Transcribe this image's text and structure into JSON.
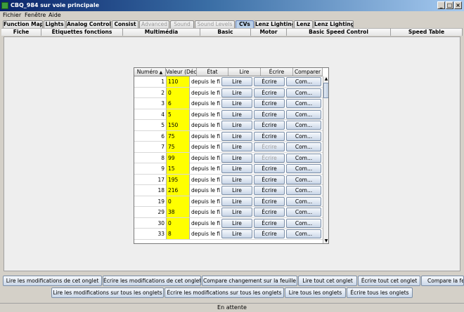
{
  "window": {
    "title": "CBQ_984 sur voie principale"
  },
  "menu": [
    "Fichier",
    "Fenêtre",
    "Aide"
  ],
  "tabs_row1": [
    {
      "label": "Function Map",
      "disabled": false,
      "selected": false
    },
    {
      "label": "Lights",
      "disabled": false,
      "selected": false
    },
    {
      "label": "Analog Controls",
      "disabled": false,
      "selected": false
    },
    {
      "label": "Consist",
      "disabled": false,
      "selected": false
    },
    {
      "label": "Advanced",
      "disabled": true,
      "selected": false
    },
    {
      "label": "Sound",
      "disabled": true,
      "selected": false
    },
    {
      "label": "Sound Levels",
      "disabled": true,
      "selected": false
    },
    {
      "label": "CVs",
      "disabled": false,
      "selected": true
    },
    {
      "label": "Lenz Lighting",
      "disabled": false,
      "selected": false
    },
    {
      "label": "Lenz",
      "disabled": false,
      "selected": false
    },
    {
      "label": "Lenz Lighting",
      "disabled": false,
      "selected": false
    }
  ],
  "tabs_row2": [
    "Fiche",
    "Étiquettes fonctions",
    "Multimédia",
    "Basic",
    "Motor",
    "Basic Speed Control",
    "Speed Table"
  ],
  "table": {
    "columns": [
      "Numéro",
      "Valeur (Déc...",
      "État",
      "Lire",
      "Écrire",
      "Comparer"
    ],
    "sort_icon": "▲",
    "rows": [
      {
        "num": "1",
        "val": "110",
        "etat": "depuis le fi...",
        "lire": "Lire",
        "ecrire": "Écrire",
        "ecrire_disabled": false,
        "comp": "Com..."
      },
      {
        "num": "2",
        "val": "0",
        "etat": "depuis le fi...",
        "lire": "Lire",
        "ecrire": "Écrire",
        "ecrire_disabled": false,
        "comp": "Com..."
      },
      {
        "num": "3",
        "val": "6",
        "etat": "depuis le fi...",
        "lire": "Lire",
        "ecrire": "Écrire",
        "ecrire_disabled": false,
        "comp": "Com..."
      },
      {
        "num": "4",
        "val": "5",
        "etat": "depuis le fi...",
        "lire": "Lire",
        "ecrire": "Écrire",
        "ecrire_disabled": false,
        "comp": "Com..."
      },
      {
        "num": "5",
        "val": "150",
        "etat": "depuis le fi...",
        "lire": "Lire",
        "ecrire": "Écrire",
        "ecrire_disabled": false,
        "comp": "Com..."
      },
      {
        "num": "6",
        "val": "75",
        "etat": "depuis le fi...",
        "lire": "Lire",
        "ecrire": "Écrire",
        "ecrire_disabled": false,
        "comp": "Com..."
      },
      {
        "num": "7",
        "val": "75",
        "etat": "depuis le fi...",
        "lire": "Lire",
        "ecrire": "Écrire",
        "ecrire_disabled": true,
        "comp": "Com..."
      },
      {
        "num": "8",
        "val": "99",
        "etat": "depuis le fi...",
        "lire": "Lire",
        "ecrire": "Écrire",
        "ecrire_disabled": true,
        "comp": "Com..."
      },
      {
        "num": "9",
        "val": "15",
        "etat": "depuis le fi...",
        "lire": "Lire",
        "ecrire": "Écrire",
        "ecrire_disabled": false,
        "comp": "Com..."
      },
      {
        "num": "17",
        "val": "195",
        "etat": "depuis le fi...",
        "lire": "Lire",
        "ecrire": "Écrire",
        "ecrire_disabled": false,
        "comp": "Com..."
      },
      {
        "num": "18",
        "val": "216",
        "etat": "depuis le fi...",
        "lire": "Lire",
        "ecrire": "Écrire",
        "ecrire_disabled": false,
        "comp": "Com..."
      },
      {
        "num": "19",
        "val": "0",
        "etat": "depuis le fi...",
        "lire": "Lire",
        "ecrire": "Écrire",
        "ecrire_disabled": false,
        "comp": "Com..."
      },
      {
        "num": "29",
        "val": "38",
        "etat": "depuis le fi...",
        "lire": "Lire",
        "ecrire": "Écrire",
        "ecrire_disabled": false,
        "comp": "Com..."
      },
      {
        "num": "30",
        "val": "0",
        "etat": "depuis le fi...",
        "lire": "Lire",
        "ecrire": "Écrire",
        "ecrire_disabled": false,
        "comp": "Com..."
      },
      {
        "num": "33",
        "val": "8",
        "etat": "depuis le fi...",
        "lire": "Lire",
        "ecrire": "Écrire",
        "ecrire_disabled": false,
        "comp": "Com..."
      }
    ]
  },
  "actions_row1": [
    "Lire les modifications de cet onglet",
    "Écrire les modifications de cet onglet",
    "Compare changement sur la feuille",
    "Lire tout cet onglet",
    "Écrire tout cet onglet",
    "Compare la feu"
  ],
  "actions_row2": [
    "Lire les modifications sur tous les onglets",
    "Écrire les modifications sur tous les onglets",
    "Lire tous les onglets",
    "Écrire tous les onglets"
  ],
  "status": "En attente",
  "colors": {
    "cv_value_bg": "#ffff00",
    "selected_tab": "#b9cfe8",
    "title_bar": "#0a246a"
  }
}
